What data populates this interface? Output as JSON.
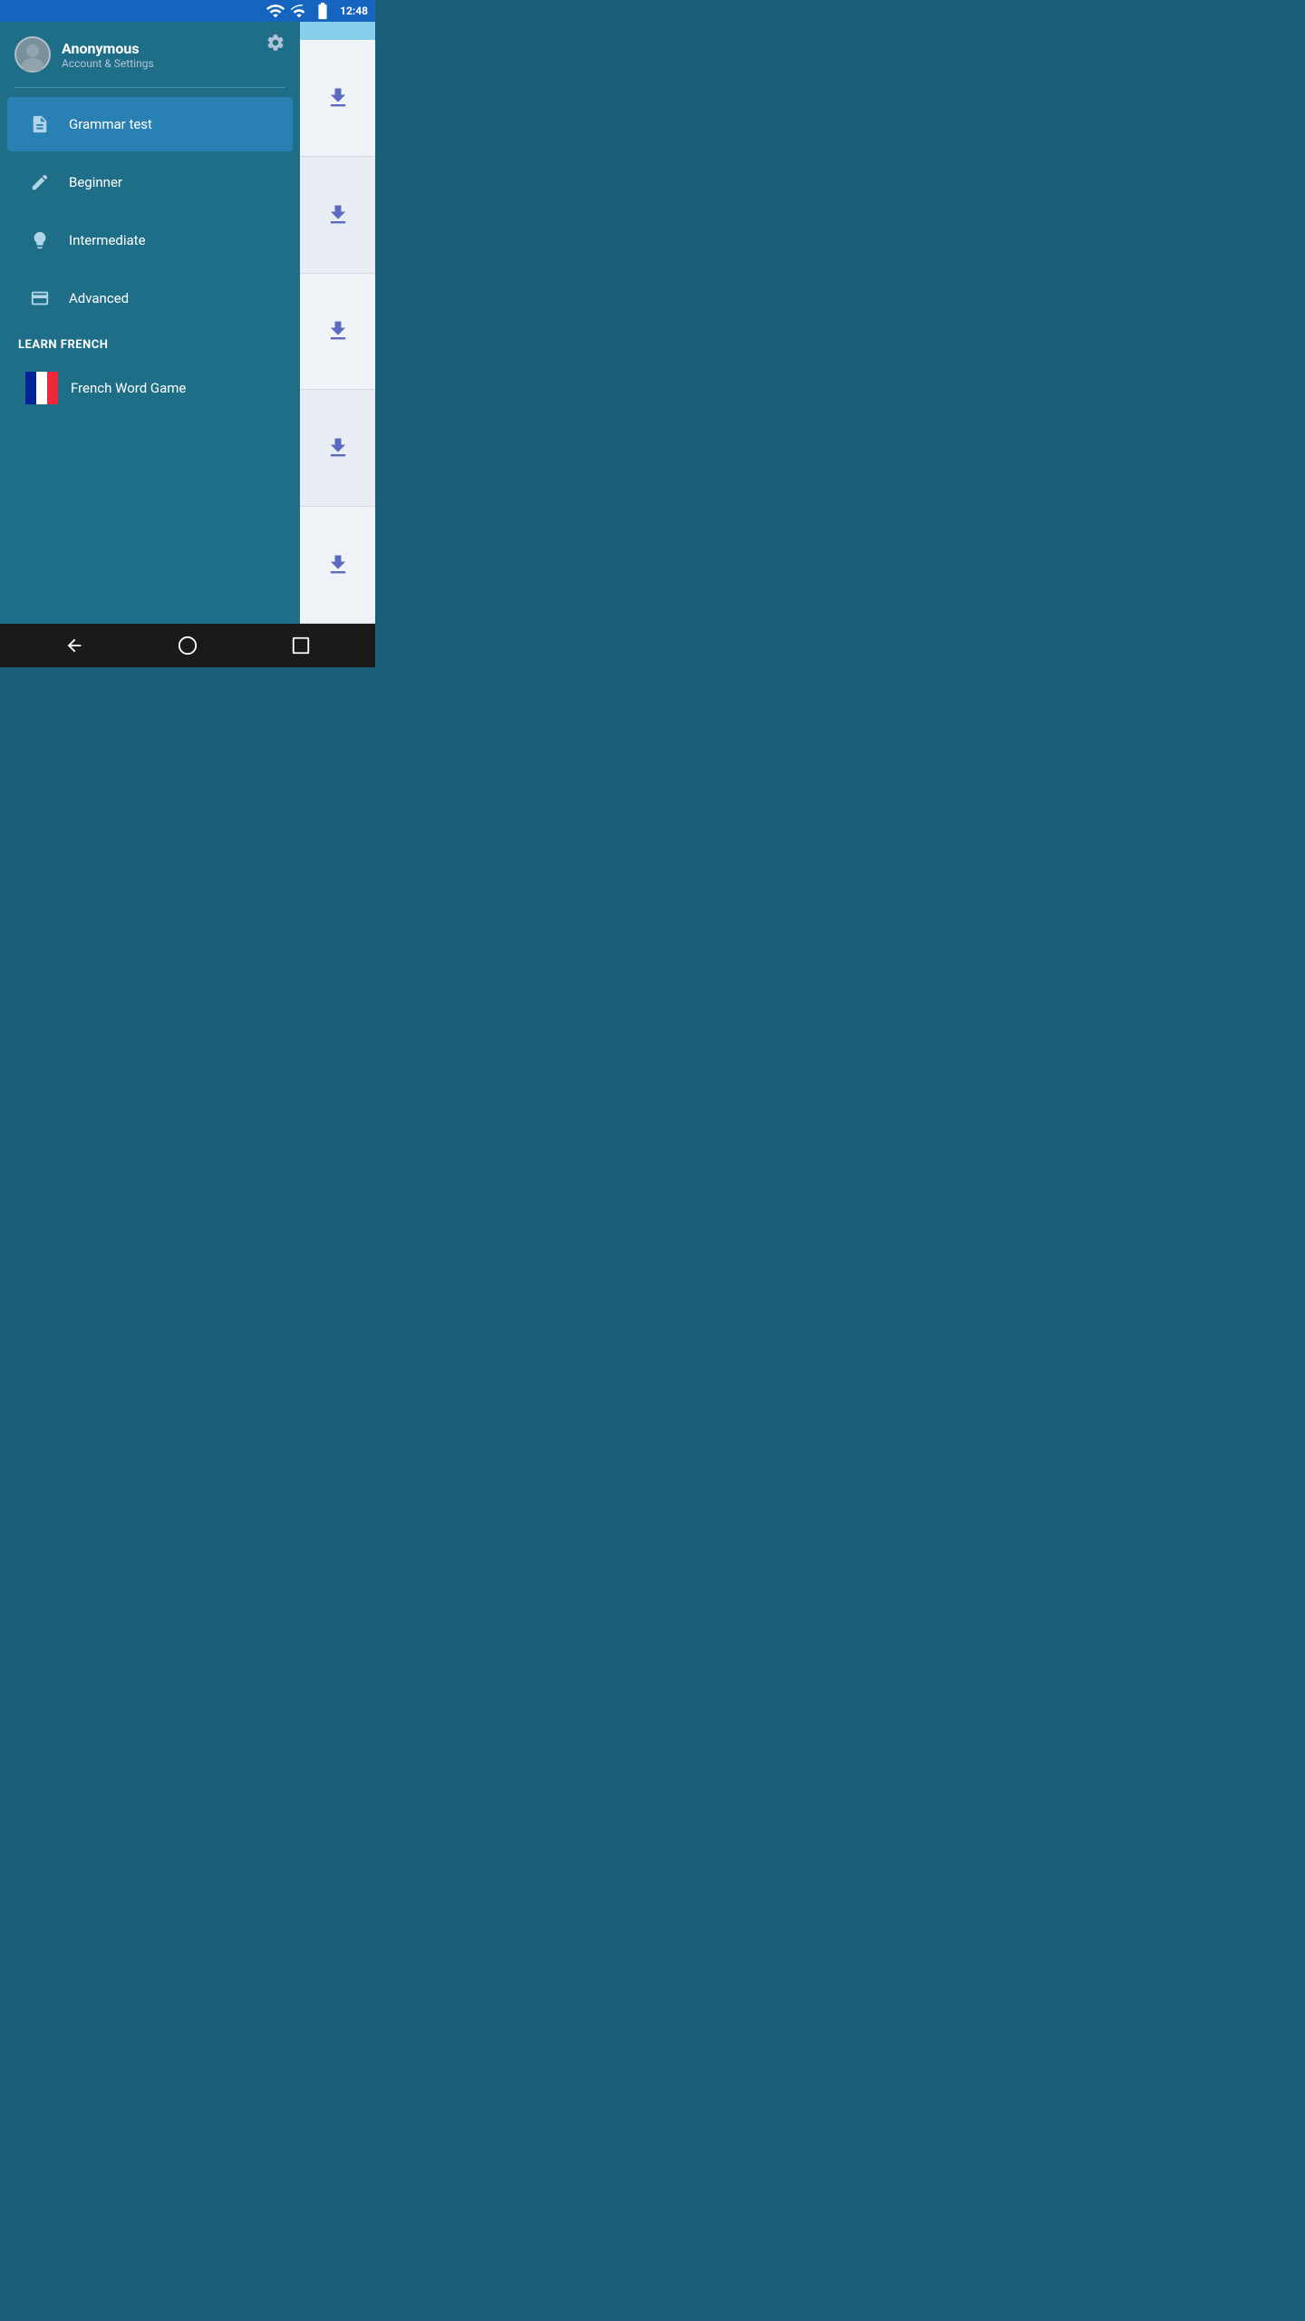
{
  "statusBar": {
    "time": "12:48",
    "icons": [
      "wifi",
      "signal",
      "battery"
    ]
  },
  "account": {
    "name": "Anonymous",
    "subtitle": "Account & Settings",
    "settingsIcon": "⚙"
  },
  "menu": {
    "items": [
      {
        "id": "grammar-test",
        "label": "Grammar test",
        "icon": "document",
        "active": true
      },
      {
        "id": "beginner",
        "label": "Beginner",
        "icon": "pencil",
        "active": false
      },
      {
        "id": "intermediate",
        "label": "Intermediate",
        "icon": "bulb",
        "active": false
      },
      {
        "id": "advanced",
        "label": "Advanced",
        "icon": "card",
        "active": false
      }
    ],
    "sections": [
      {
        "label": "LEARN FRENCH",
        "items": [
          {
            "id": "french-word-game",
            "label": "French Word Game",
            "icon": "french-flag",
            "active": false
          }
        ]
      }
    ]
  },
  "rightPanel": {
    "downloadCells": [
      {
        "id": "dl-1"
      },
      {
        "id": "dl-2"
      },
      {
        "id": "dl-3"
      },
      {
        "id": "dl-4"
      },
      {
        "id": "dl-5"
      }
    ]
  },
  "bottomNav": {
    "back": "◁",
    "home": "○",
    "recent": "□"
  }
}
